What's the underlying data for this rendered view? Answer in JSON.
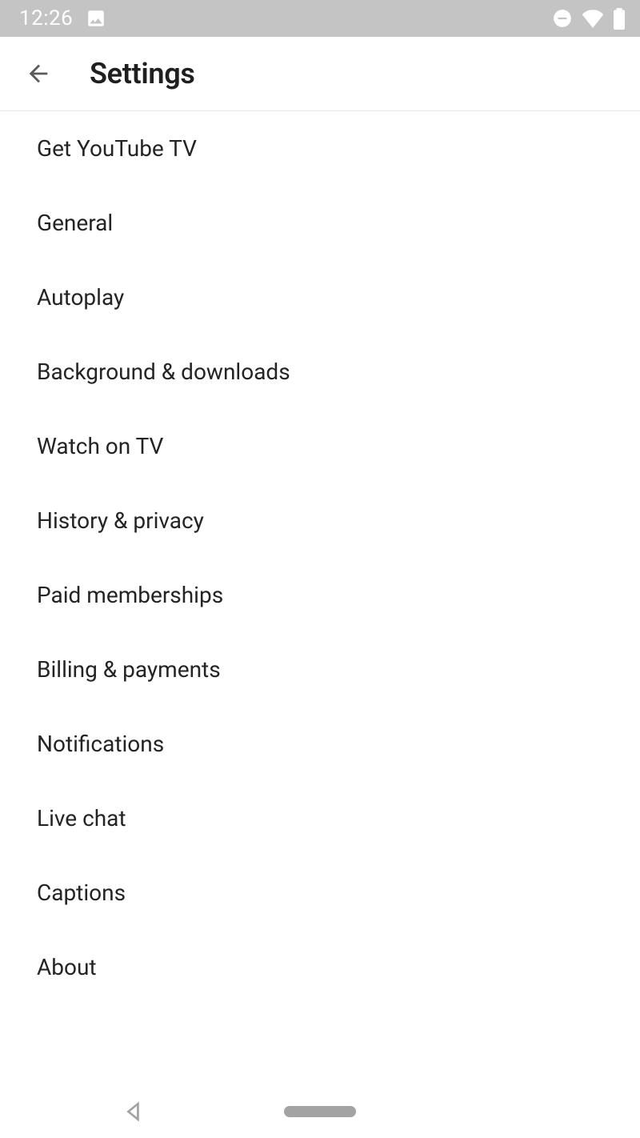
{
  "status_bar": {
    "time": "12:26"
  },
  "app_bar": {
    "title": "Settings"
  },
  "settings": {
    "items": [
      {
        "label": "Get YouTube TV"
      },
      {
        "label": "General"
      },
      {
        "label": "Autoplay"
      },
      {
        "label": "Background & downloads"
      },
      {
        "label": "Watch on TV"
      },
      {
        "label": "History & privacy"
      },
      {
        "label": "Paid memberships"
      },
      {
        "label": "Billing & payments"
      },
      {
        "label": "Notifications"
      },
      {
        "label": "Live chat"
      },
      {
        "label": "Captions"
      },
      {
        "label": "About"
      }
    ]
  }
}
